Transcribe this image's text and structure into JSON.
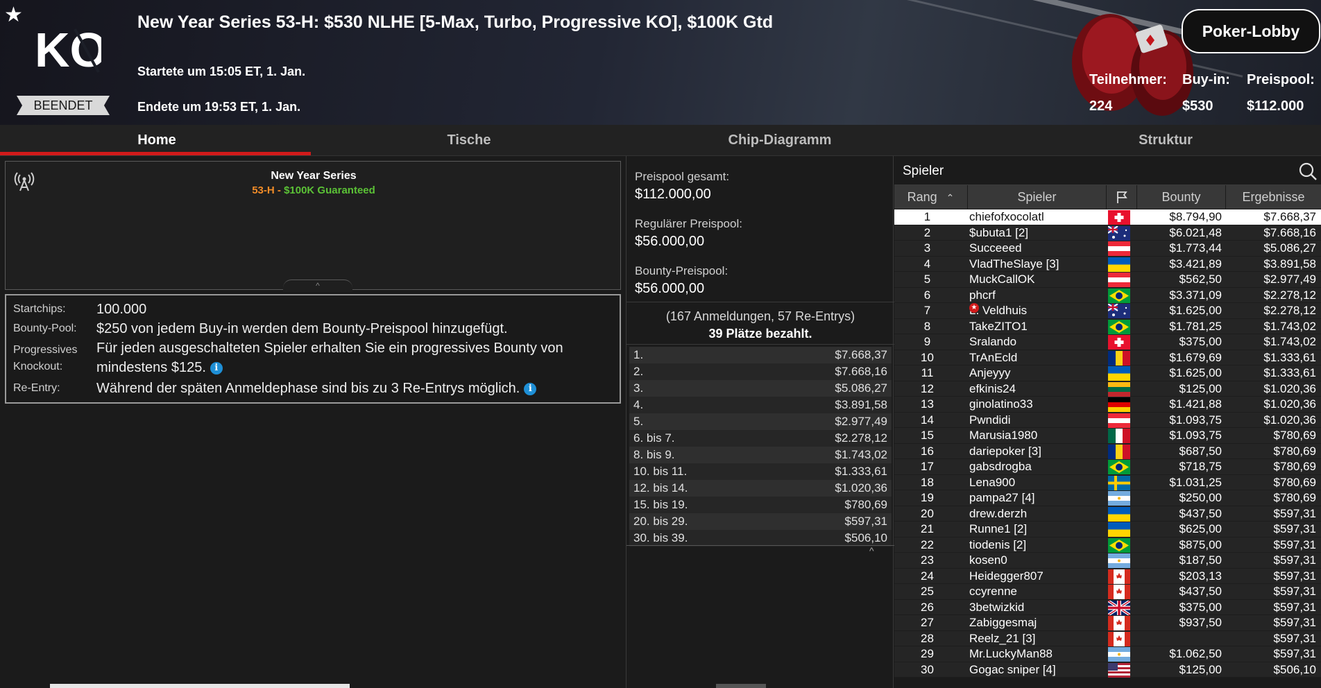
{
  "header": {
    "title": "New Year Series 53-H: $530 NLHE [5-Max, Turbo, Progressive KO], $100K Gtd",
    "status": "BEENDET",
    "start_time": "Startete um 15:05 ET, 1. Jan.",
    "end_time": "Endete um 19:53 ET, 1. Jan.",
    "lobby_button": "Poker-Lobby",
    "participants_label": "Teilnehmer:",
    "participants_value": "224",
    "buyin_label": "Buy-in:",
    "buyin_value": "$530",
    "prizepool_label": "Preispool:",
    "prizepool_value": "$112.000",
    "logo_text": "KO",
    "icons": [
      "star-icon",
      "ko-logo",
      "boxing-gloves"
    ]
  },
  "tabs": [
    "Home",
    "Tische",
    "Chip-Diagramm",
    "Struktur"
  ],
  "info": {
    "series": "New Year Series",
    "code": "53-H",
    "separator": " - ",
    "guarantee": "$100K Guaranteed",
    "colors": {
      "code": "#f28c28",
      "guarantee": "#5bc236"
    }
  },
  "details": {
    "startchips_label": "Startchips:",
    "startchips_value": "100.000",
    "bountypool_label": "Bounty-Pool:",
    "bountypool_value": "$250 von jedem Buy-in werden dem Bounty-Preispool hinzugefügt.",
    "pko_label": "Progressives Knockout:",
    "pko_value": "Für jeden ausgeschalteten Spieler erhalten Sie ein progressives Bounty von mindestens $125.",
    "reentry_label": "Re-Entry:",
    "reentry_value": "Während der späten Anmeldephase sind bis zu 3 Re-Entrys möglich."
  },
  "prizepool": {
    "total_label": "Preispool gesamt:",
    "total_value": "$112.000,00",
    "regular_label": "Regulärer Preispool:",
    "regular_value": "$56.000,00",
    "bounty_label": "Bounty-Preispool:",
    "bounty_value": "$56.000,00",
    "entries_text": "(167 Anmeldungen, 57 Re-Entrys)",
    "paid_text": "39 Plätze bezahlt.",
    "payouts": [
      {
        "place": "1.",
        "amount": "$7.668,37"
      },
      {
        "place": "2.",
        "amount": "$7.668,16"
      },
      {
        "place": "3.",
        "amount": "$5.086,27"
      },
      {
        "place": "4.",
        "amount": "$3.891,58"
      },
      {
        "place": "5.",
        "amount": "$2.977,49"
      },
      {
        "place": "6. bis 7.",
        "amount": "$2.278,12"
      },
      {
        "place": "8. bis 9.",
        "amount": "$1.743,02"
      },
      {
        "place": "10. bis 11.",
        "amount": "$1.333,61"
      },
      {
        "place": "12. bis 14.",
        "amount": "$1.020,36"
      },
      {
        "place": "15. bis 19.",
        "amount": "$780,69"
      },
      {
        "place": "20. bis 29.",
        "amount": "$597,31"
      },
      {
        "place": "30. bis 39.",
        "amount": "$506,10"
      }
    ]
  },
  "players": {
    "title": "Spieler",
    "columns": {
      "rank": "Rang",
      "player": "Spieler",
      "bounty": "Bounty",
      "result": "Ergebnisse"
    },
    "rows": [
      {
        "rank": "1",
        "name": "chiefofxocolatl",
        "flag": "ch",
        "bounty": "$8.794,90",
        "result": "$7.668,37"
      },
      {
        "rank": "2",
        "name": "$ubuta1 [2]",
        "flag": "au",
        "bounty": "$6.021,48",
        "result": "$7.668,16"
      },
      {
        "rank": "3",
        "name": "Succeeed",
        "flag": "at",
        "bounty": "$1.773,44",
        "result": "$5.086,27"
      },
      {
        "rank": "4",
        "name": "VladTheSlaye [3]",
        "flag": "ua",
        "bounty": "$3.421,89",
        "result": "$3.891,58"
      },
      {
        "rank": "5",
        "name": "MuckCallOK",
        "flag": "at",
        "bounty": "$562,50",
        "result": "$2.977,49"
      },
      {
        "rank": "6",
        "name": "phcrf",
        "flag": "br",
        "bounty": "$3.371,09",
        "result": "$2.278,12"
      },
      {
        "rank": "7",
        "name": "L. Veldhuis",
        "flag": "au",
        "bounty": "$1.625,00",
        "result": "$2.278,12",
        "ko": true
      },
      {
        "rank": "8",
        "name": "TakeZITO1",
        "flag": "br",
        "bounty": "$1.781,25",
        "result": "$1.743,02"
      },
      {
        "rank": "9",
        "name": "Sralando",
        "flag": "ch",
        "bounty": "$375,00",
        "result": "$1.743,02"
      },
      {
        "rank": "10",
        "name": "TrAnEcld",
        "flag": "ro",
        "bounty": "$1.679,69",
        "result": "$1.333,61"
      },
      {
        "rank": "11",
        "name": "Anjeyyy",
        "flag": "ua",
        "bounty": "$1.625,00",
        "result": "$1.333,61"
      },
      {
        "rank": "12",
        "name": "efkinis24",
        "flag": "lt",
        "bounty": "$125,00",
        "result": "$1.020,36"
      },
      {
        "rank": "13",
        "name": "ginolatino33",
        "flag": "de",
        "bounty": "$1.421,88",
        "result": "$1.020,36"
      },
      {
        "rank": "14",
        "name": "Pwndidi",
        "flag": "at",
        "bounty": "$1.093,75",
        "result": "$1.020,36"
      },
      {
        "rank": "15",
        "name": "Marusia1980",
        "flag": "mx",
        "bounty": "$1.093,75",
        "result": "$780,69"
      },
      {
        "rank": "16",
        "name": "dariepoker [3]",
        "flag": "ro",
        "bounty": "$687,50",
        "result": "$780,69"
      },
      {
        "rank": "17",
        "name": "gabsdrogba",
        "flag": "br",
        "bounty": "$718,75",
        "result": "$780,69"
      },
      {
        "rank": "18",
        "name": "Lena900",
        "flag": "se",
        "bounty": "$1.031,25",
        "result": "$780,69"
      },
      {
        "rank": "19",
        "name": "pampa27 [4]",
        "flag": "ar",
        "bounty": "$250,00",
        "result": "$780,69"
      },
      {
        "rank": "20",
        "name": "drew.derzh",
        "flag": "ua",
        "bounty": "$437,50",
        "result": "$597,31"
      },
      {
        "rank": "21",
        "name": "Runne1 [2]",
        "flag": "ua",
        "bounty": "$625,00",
        "result": "$597,31"
      },
      {
        "rank": "22",
        "name": "tiodenis [2]",
        "flag": "br",
        "bounty": "$875,00",
        "result": "$597,31"
      },
      {
        "rank": "23",
        "name": "kosen0",
        "flag": "ar",
        "bounty": "$187,50",
        "result": "$597,31"
      },
      {
        "rank": "24",
        "name": "Heidegger807",
        "flag": "ca",
        "bounty": "$203,13",
        "result": "$597,31"
      },
      {
        "rank": "25",
        "name": "ccyrenne",
        "flag": "ca",
        "bounty": "$437,50",
        "result": "$597,31"
      },
      {
        "rank": "26",
        "name": "3betwizkid",
        "flag": "gb",
        "bounty": "$375,00",
        "result": "$597,31"
      },
      {
        "rank": "27",
        "name": "Zabiggesmaj",
        "flag": "ca",
        "bounty": "$937,50",
        "result": "$597,31"
      },
      {
        "rank": "28",
        "name": "Reelz_21 [3]",
        "flag": "ca",
        "bounty": "",
        "result": "$597,31"
      },
      {
        "rank": "29",
        "name": "Mr.LuckyMan88",
        "flag": "ar",
        "bounty": "$1.062,50",
        "result": "$597,31"
      },
      {
        "rank": "30",
        "name": "Gogac sniper [4]",
        "flag": "us",
        "bounty": "$125,00",
        "result": "$506,10"
      }
    ]
  }
}
